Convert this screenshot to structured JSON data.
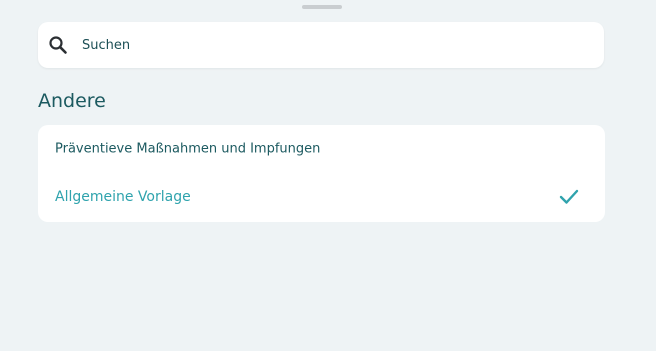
{
  "search": {
    "placeholder": "Suchen",
    "icon": "search-icon"
  },
  "section": {
    "title": "Andere",
    "items": [
      {
        "label": "Präventieve Maßnahmen und Impfungen",
        "selected": false
      },
      {
        "label": "Allgemeine Vorlage",
        "selected": true
      }
    ]
  },
  "colors": {
    "background": "#eef3f5",
    "primary_text": "#1c5a60",
    "accent": "#2fa3ad"
  }
}
